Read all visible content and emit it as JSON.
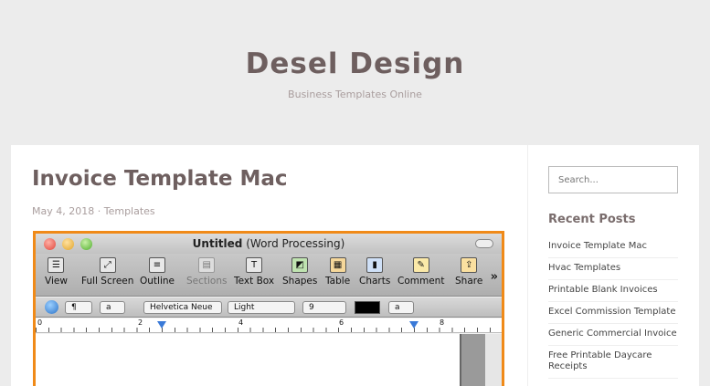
{
  "site": {
    "title": "Desel Design",
    "description": "Business Templates Online"
  },
  "post": {
    "title": "Invoice Template Mac",
    "date": "May 4, 2018",
    "separator": "·",
    "category": "Templates"
  },
  "screenshot": {
    "window_title": "Untitled",
    "window_subtitle": "(Word Processing)",
    "toolbar": [
      {
        "label": "View",
        "icon": "view-icon"
      },
      {
        "label": "Full Screen",
        "icon": "full-screen-icon"
      },
      {
        "label": "Outline",
        "icon": "outline-icon"
      },
      {
        "label": "Sections",
        "icon": "sections-icon"
      },
      {
        "label": "Text Box",
        "icon": "text-box-icon"
      },
      {
        "label": "Shapes",
        "icon": "shapes-icon"
      },
      {
        "label": "Table",
        "icon": "table-icon"
      },
      {
        "label": "Charts",
        "icon": "charts-icon"
      },
      {
        "label": "Comment",
        "icon": "comment-icon"
      },
      {
        "label": "Share",
        "icon": "share-icon"
      }
    ],
    "more": "»",
    "format": {
      "paragraph": "¶",
      "style": "a",
      "font": "Helvetica Neue",
      "weight": "Light",
      "size": "9",
      "text_color_sample": "a"
    },
    "ruler": [
      "0",
      "2",
      "4",
      "6",
      "8"
    ]
  },
  "sidebar": {
    "search_placeholder": "Search...",
    "recent_posts_title": "Recent Posts",
    "recent_posts": [
      "Invoice Template Mac",
      "Hvac Templates",
      "Printable Blank Invoices",
      "Excel Commission Template",
      "Generic Commercial Invoice",
      "Free Printable Daycare Receipts"
    ]
  },
  "colors": {
    "accent_border": "#f08a18",
    "title_text": "#6e5f5f",
    "background": "#ececec"
  }
}
